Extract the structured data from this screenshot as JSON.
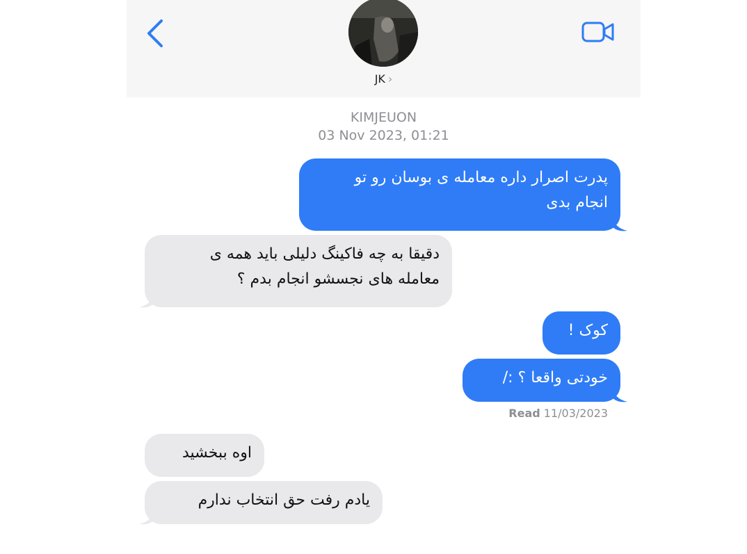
{
  "header": {
    "contact_name": "JK",
    "chevron": "›",
    "back_icon": "chevron-left-icon",
    "video_icon": "video-camera-icon",
    "accent_color": "#2f7cf6"
  },
  "thread": {
    "sender_label": "KIMJEUON",
    "timestamp": "03 Nov 2023, 01:21"
  },
  "messages": [
    {
      "direction": "outgoing",
      "lines": [
        "پدرت اصرار داره معامله ی بوسان رو تو",
        "انجام بدی"
      ]
    },
    {
      "direction": "incoming",
      "lines": [
        "دقیقا به چه فاکینگ دلیلی باید همه ی",
        "معامله های نجسشو انجام بدم ؟"
      ]
    },
    {
      "direction": "outgoing",
      "lines": [
        "کوک !"
      ]
    },
    {
      "direction": "outgoing",
      "lines": [
        "خودتی واقعا ؟ :/"
      ]
    },
    {
      "direction": "incoming",
      "lines": [
        "اوه ببخشید"
      ]
    },
    {
      "direction": "incoming",
      "lines": [
        "یادم رفت حق انتخاب ندارم"
      ]
    }
  ],
  "receipt": {
    "label": "Read",
    "date": "11/03/2023"
  }
}
